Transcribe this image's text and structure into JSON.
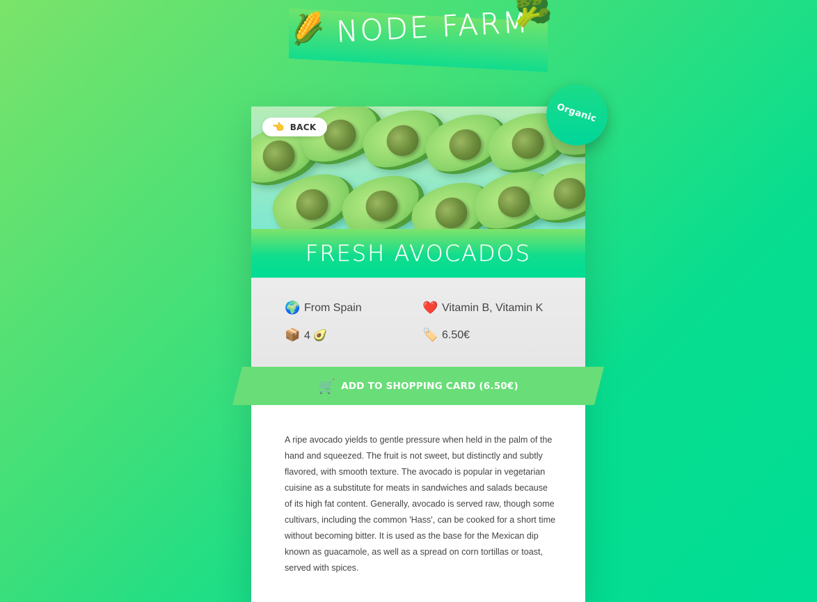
{
  "header": {
    "title": "Node Farm",
    "left_icon": "🌽",
    "right_icon": "🥦"
  },
  "product": {
    "name": "Fresh Avocados",
    "badge": "Organic",
    "back_label": "BACK",
    "back_icon": "👈",
    "from_icon": "🌍",
    "from": "From Spain",
    "nutrients_icon": "❤️",
    "nutrients": "Vitamin B, Vitamin K",
    "quantity_icon": "📦",
    "quantity": "4 🥑",
    "price_icon": "🏷️",
    "price": "6.50€",
    "cart_icon": "🛒",
    "cart_label": "ADD TO SHOPPING CARD (6.50€)",
    "description": "A ripe avocado yields to gentle pressure when held in the palm of the hand and squeezed. The fruit is not sweet, but distinctly and subtly flavored, with smooth texture. The avocado is popular in vegetarian cuisine as a substitute for meats in sandwiches and salads because of its high fat content. Generally, avocado is served raw, though some cultivars, including the common 'Hass', can be cooked for a short time without becoming bitter. It is used as the base for the Mexican dip known as guacamole, as well as a spread on corn tortillas or toast, served with spices."
  },
  "colors": {
    "accent_green": "#69dd77",
    "gradient_start": "#7be36a",
    "gradient_end": "#00dd95"
  }
}
